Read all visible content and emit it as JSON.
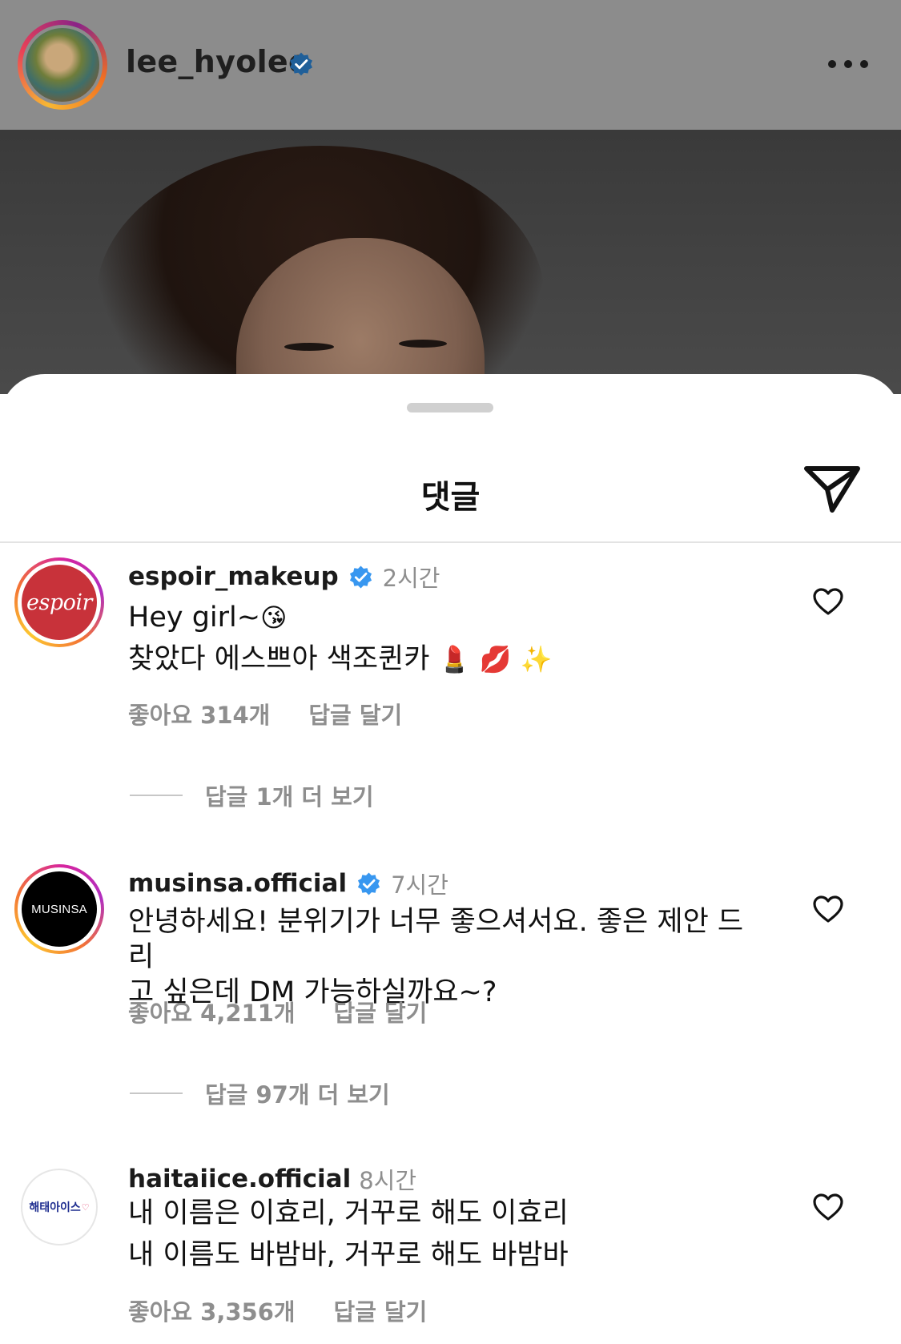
{
  "post": {
    "username": "lee_hyolee",
    "verified": true
  },
  "sheet": {
    "title": "댓글"
  },
  "comments": [
    {
      "username": "espoir_makeup",
      "verified": true,
      "time": "2시간",
      "avatar_text": "espoir",
      "lines": [
        "Hey girl~",
        "찾았다 에스쁘아 색조퀸카"
      ],
      "emojis": [
        "😘",
        "💄",
        "💋",
        "✨"
      ],
      "likes": "좋아요 314개",
      "reply_label": "답글 달기",
      "more_replies": "답글 1개 더 보기"
    },
    {
      "username": "musinsa.official",
      "verified": true,
      "time": "7시간",
      "avatar_text": "MUSINSA",
      "lines": [
        "안녕하세요! 분위기가 너무 좋으셔서요. 좋은 제안 드리",
        "고 싶은데 DM 가능하실까요~?"
      ],
      "likes": "좋아요 4,211개",
      "reply_label": "답글 달기",
      "more_replies": "답글 97개 더 보기"
    },
    {
      "username": "haitaiice.official",
      "verified": false,
      "time": "8시간",
      "avatar_text": "해태아이스",
      "lines": [
        "내 이름은 이효리, 거꾸로 해도 이효리",
        "내 이름도 바밤바, 거꾸로 해도 바밤바"
      ],
      "likes": "좋아요 3,356개",
      "reply_label": "답글 달기"
    }
  ],
  "colors": {
    "verified_blue": "#3897f0",
    "secondary_text": "#8e8e8e",
    "espoir_red": "#c8323a"
  },
  "icons": [
    "more-icon",
    "verified-badge-icon",
    "send-icon",
    "heart-outline-icon"
  ]
}
